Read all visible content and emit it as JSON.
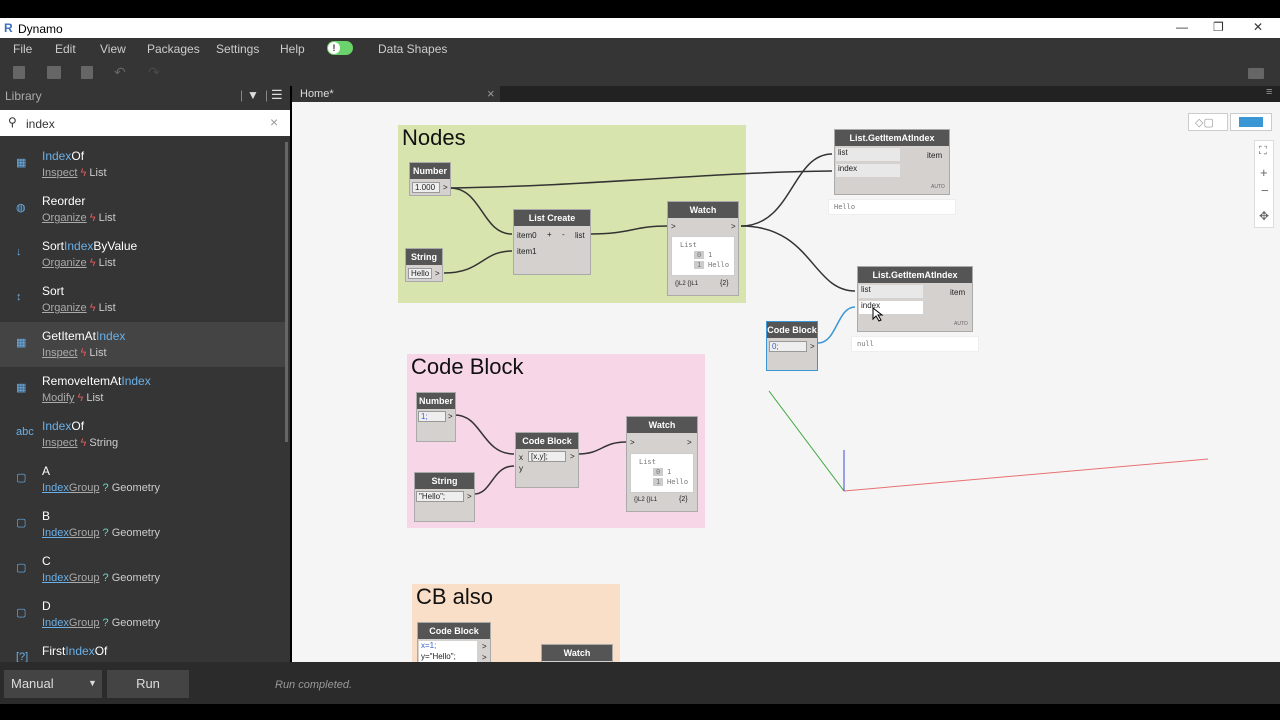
{
  "window": {
    "title": "Dynamo",
    "logo": "R",
    "min": "—",
    "max": "❐",
    "close": "✕"
  },
  "menu": {
    "file": "File",
    "edit": "Edit",
    "view": "View",
    "packages": "Packages",
    "settings": "Settings",
    "help": "Help",
    "datashapes": "Data Shapes",
    "toggle_glyph": "!"
  },
  "library": {
    "title": "Library",
    "search_value": "index",
    "search_clear": "×",
    "items": [
      {
        "pre": "",
        "hl": "Index",
        "post": "Of",
        "cat": "Inspect",
        "type": "List",
        "catlink": false
      },
      {
        "pre": "Reorder",
        "hl": "",
        "post": "",
        "cat": "Organize",
        "type": "List",
        "catlink": false
      },
      {
        "pre": "Sort",
        "hl": "Index",
        "post": "ByValue",
        "cat": "Organize",
        "type": "List",
        "catlink": false
      },
      {
        "pre": "Sort",
        "hl": "",
        "post": "",
        "cat": "Organize",
        "type": "List",
        "catlink": false
      },
      {
        "pre": "GetItemAt",
        "hl": "Index",
        "post": "",
        "cat": "Inspect",
        "type": "List",
        "catlink": false
      },
      {
        "pre": "RemoveItemAt",
        "hl": "Index",
        "post": "",
        "cat": "Modify",
        "type": "List",
        "catlink": false
      },
      {
        "pre": "",
        "hl": "Index",
        "post": "Of",
        "cat": "Inspect",
        "type": "String",
        "catlink": false
      },
      {
        "pre": "A",
        "hl": "",
        "post": "",
        "cat_hl": "Index",
        "cat": "Group",
        "type": "Geometry",
        "catlink": true
      },
      {
        "pre": "B",
        "hl": "",
        "post": "",
        "cat_hl": "Index",
        "cat": "Group",
        "type": "Geometry",
        "catlink": true
      },
      {
        "pre": "C",
        "hl": "",
        "post": "",
        "cat_hl": "Index",
        "cat": "Group",
        "type": "Geometry",
        "catlink": true
      },
      {
        "pre": "D",
        "hl": "",
        "post": "",
        "cat_hl": "Index",
        "cat": "Group",
        "type": "Geometry",
        "catlink": true
      },
      {
        "pre": "First",
        "hl": "Index",
        "post": "Of",
        "cat": "",
        "type": "",
        "catlink": false
      }
    ]
  },
  "tab": {
    "label": "Home*",
    "close": "×"
  },
  "canvas": {
    "groups": {
      "nodes": "Nodes",
      "codeblock": "Code Block",
      "cbalso": "CB also"
    },
    "n_number1": {
      "title": "Number",
      "value": "1.000"
    },
    "n_string1": {
      "title": "String",
      "value": "Hello"
    },
    "n_listcreate": {
      "title": "List Create",
      "in0": "item0",
      "in1": "item1",
      "plus": "+",
      "minus": "-",
      "out": "list"
    },
    "n_watch1": {
      "title": "Watch",
      "l1": "List",
      "i0": "0",
      "v0": "1",
      "i1": "1",
      "v1": "Hello",
      "foot": "{}L2 {}L1",
      "count": "{2}"
    },
    "n_getitem1": {
      "title": "List.GetItemAtIndex",
      "in0": "list",
      "in1": "index",
      "out": "item",
      "auto": "AUTO",
      "preview": "Hello"
    },
    "n_getitem2": {
      "title": "List.GetItemAtIndex",
      "in0": "list",
      "in1": "index",
      "out": "item",
      "auto": "AUTO",
      "preview": "null"
    },
    "n_cb0": {
      "title": "Code Block",
      "code": "0;"
    },
    "n_number2": {
      "title": "Number",
      "value": "1;"
    },
    "n_string2": {
      "title": "String",
      "value": "\"Hello\";"
    },
    "n_cb1": {
      "title": "Code Block",
      "code": "[x,y];",
      "in0": "x",
      "in1": "y"
    },
    "n_watch2": {
      "title": "Watch",
      "l1": "List",
      "i0": "0",
      "v0": "1",
      "i1": "1",
      "v1": "Hello",
      "foot": "{}L2 {}L1",
      "count": "{2}"
    },
    "n_cb2": {
      "title": "Code Block",
      "line1": "x=1;",
      "line2": "y=\"Hello\";"
    },
    "n_watch3": {
      "title": "Watch"
    }
  },
  "status": {
    "mode": "Manual",
    "run": "Run",
    "message": "Run completed."
  }
}
